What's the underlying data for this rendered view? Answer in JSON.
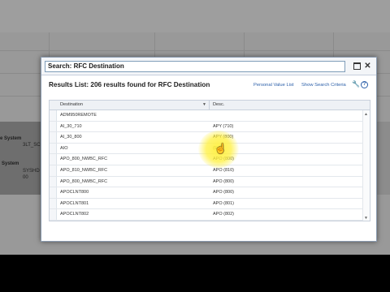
{
  "background": {
    "labels": [
      {
        "text": "e System",
        "pos": "a"
      },
      {
        "text": "System",
        "pos": "b"
      }
    ],
    "values": [
      {
        "text": "3LT_SC",
        "pos": "a"
      },
      {
        "text": "SYSHD",
        "pos": "b"
      },
      {
        "text": "00",
        "pos": "c"
      }
    ]
  },
  "dialog": {
    "title": "Search: RFC Destination",
    "results_heading": "Results List: 206 results found for RFC Destination",
    "links": {
      "personal_value_list": "Personal Value List",
      "show_search_criteria": "Show Search Criteria"
    },
    "table": {
      "columns": {
        "destination": "Destination",
        "desc": "Desc."
      },
      "rows": [
        {
          "destination": "ADM950REMOTE",
          "desc": ""
        },
        {
          "destination": "AI_30_710",
          "desc": "APY (710)"
        },
        {
          "destination": "AI_30_800",
          "desc": "APY (800)"
        },
        {
          "destination": "AIO",
          "desc": "(E...)"
        },
        {
          "destination": "APO_800_NWBC_RFC",
          "desc": "APO (800)"
        },
        {
          "destination": "APO_810_NWBC_RFC",
          "desc": "APO (810)"
        },
        {
          "destination": "APO_800_NWBC_RFC",
          "desc": "APO (800)"
        },
        {
          "destination": "APOCLNT800",
          "desc": "APO (800)"
        },
        {
          "destination": "APOCLNT801",
          "desc": "APO (801)"
        },
        {
          "destination": "APOCLNT802",
          "desc": "APO (802)"
        }
      ]
    }
  },
  "icons": {
    "maximize": "maximize-icon",
    "close": "close-icon",
    "wrench": "wrench-icon",
    "help": "help-icon",
    "sort": "sort-descending-icon",
    "scroll_up": "chevron-up-icon",
    "scroll_down": "chevron-down-icon",
    "cursor": "hand-pointer-icon"
  },
  "colors": {
    "link": "#2a5ea8",
    "highlight": "#fff03c"
  }
}
